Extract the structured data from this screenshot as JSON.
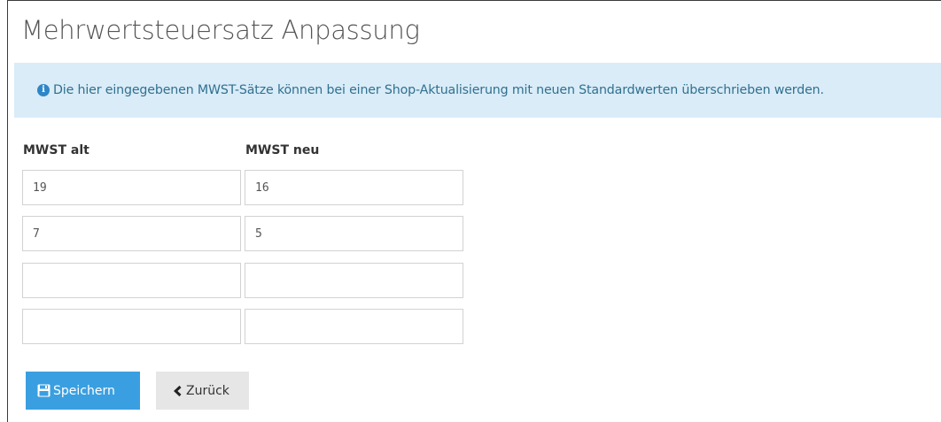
{
  "page": {
    "title": "Mehrwertsteuersatz Anpassung"
  },
  "alert": {
    "icon": "info-circle-icon",
    "text": "Die hier eingegebenen MWST-Sätze können bei einer Shop-Aktualisierung mit neuen Standardwerten überschrieben werden."
  },
  "table": {
    "headers": {
      "alt": "MWST alt",
      "neu": "MWST neu"
    },
    "rows": [
      {
        "alt": "19",
        "neu": "16"
      },
      {
        "alt": "7",
        "neu": "5"
      },
      {
        "alt": "",
        "neu": ""
      },
      {
        "alt": "",
        "neu": ""
      }
    ]
  },
  "buttons": {
    "save_label": "Speichern",
    "save_icon": "floppy-disk-icon",
    "save_color": "#3a9fe0",
    "back_label": "Zurück",
    "back_icon": "chevron-left-icon"
  }
}
